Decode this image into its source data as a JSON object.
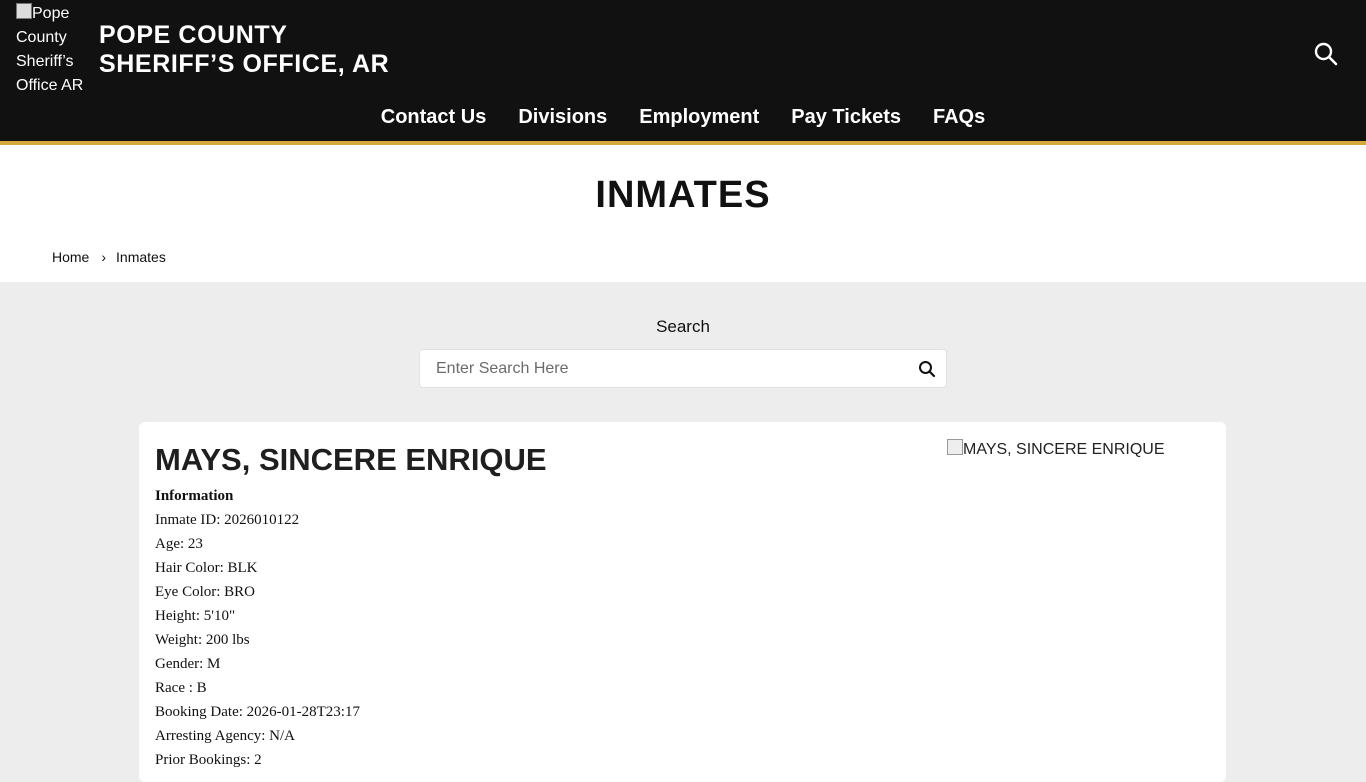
{
  "header": {
    "logo_alt": "Pope County Sheriff’s Office AR",
    "title_line1": "POPE COUNTY",
    "title_line2": "SHERIFF’S OFFICE, AR",
    "nav": [
      "Contact Us",
      "Divisions",
      "Employment",
      "Pay Tickets",
      "FAQs"
    ]
  },
  "page": {
    "title": "INMATES",
    "breadcrumb": {
      "home": "Home",
      "separator": "›",
      "current": "Inmates"
    }
  },
  "search": {
    "label": "Search",
    "placeholder": "Enter Search Here"
  },
  "inmate": {
    "name": "MAYS, SINCERE ENRIQUE",
    "photo_alt": "MAYS, SINCERE ENRIQUE",
    "section_heading": "Information",
    "fields": [
      "Inmate ID: 2026010122",
      "Age: 23",
      "Hair Color: BLK",
      "Eye Color: BRO",
      "Height: 5'10\"",
      "Weight: 200 lbs",
      "Gender: M",
      "Race : B",
      "Booking Date: 2026-01-28T23:17",
      "Arresting Agency: N/A",
      "Prior Bookings: 2"
    ]
  },
  "colors": {
    "header_bg": "#111111",
    "accent_border": "#d4a93a",
    "page_bg": "#ededed"
  }
}
